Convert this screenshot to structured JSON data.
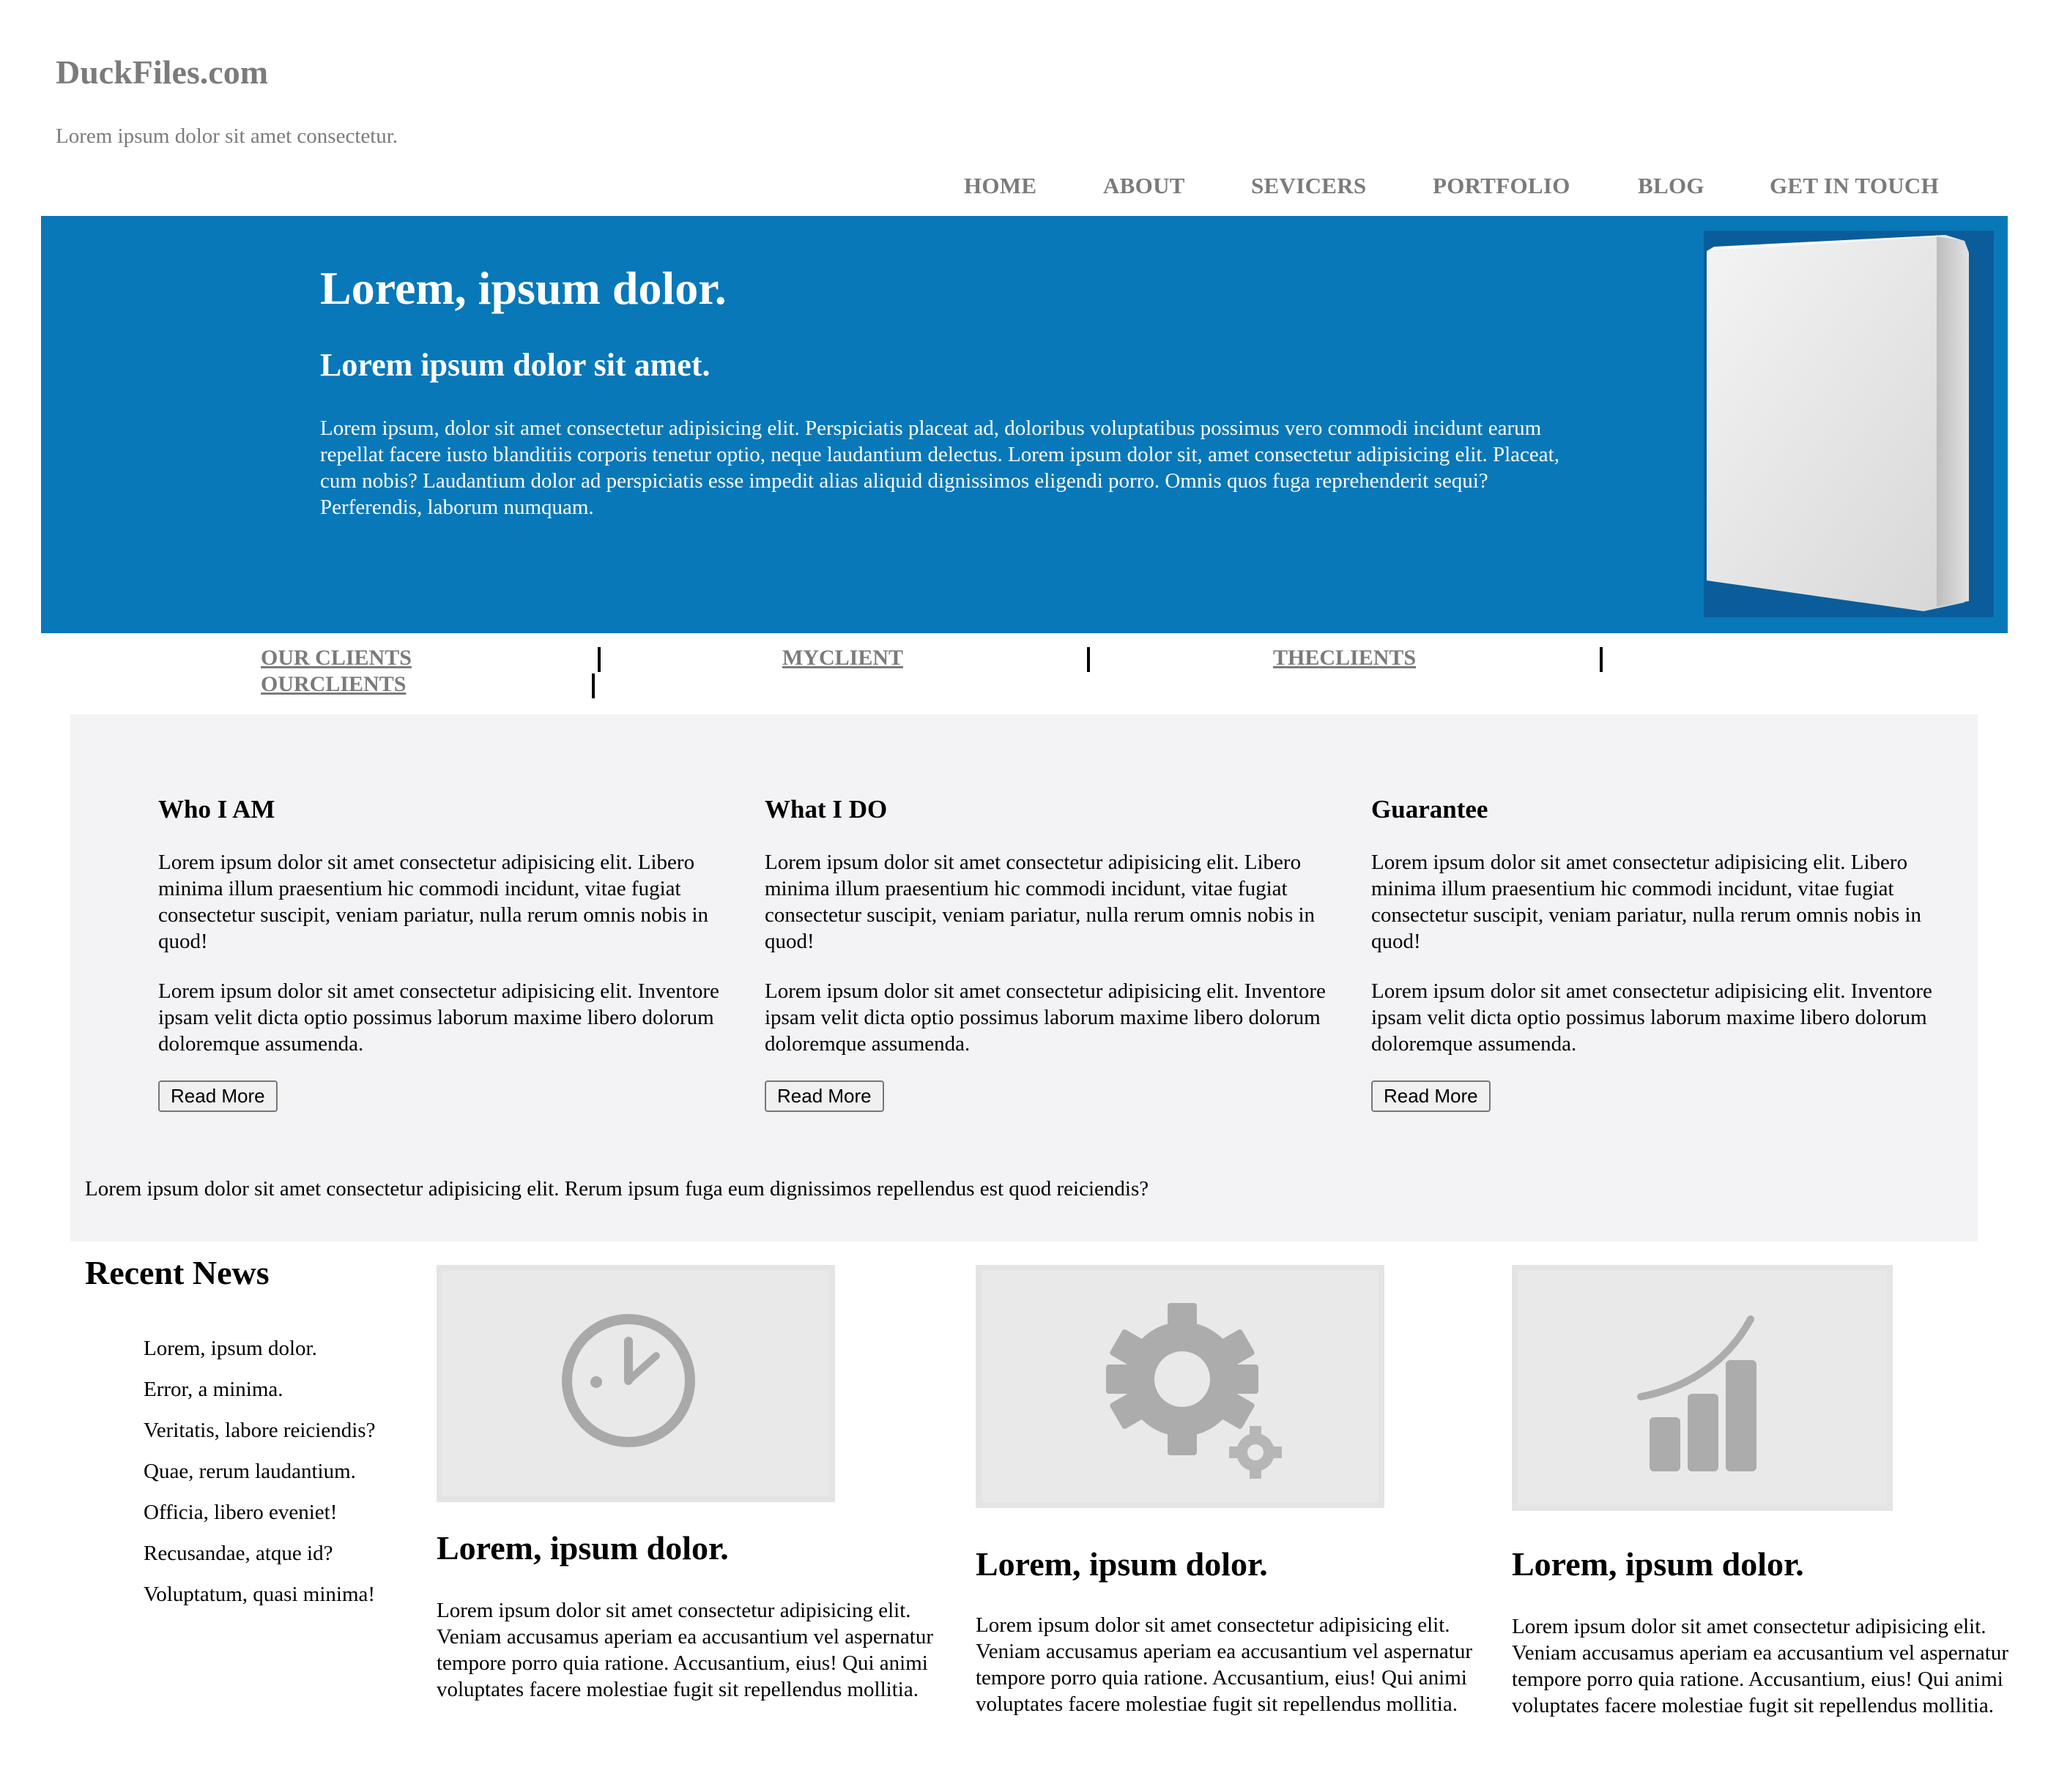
{
  "header": {
    "site_title": "DuckFiles.com",
    "tagline": "Lorem ipsum dolor sit amet consectetur."
  },
  "nav": [
    "HOME",
    "ABOUT",
    "SEVICERS",
    "PORTFOLIO",
    "BLOG",
    "GET IN TOUCH"
  ],
  "hero": {
    "title": "Lorem, ipsum dolor.",
    "subtitle": "Lorem ipsum dolor sit amet.",
    "text": "Lorem ipsum, dolor sit amet consectetur adipisicing elit. Perspiciatis placeat ad, doloribus voluptatibus possimus vero commodi incidunt earum repellat facere iusto blanditiis corporis tenetur optio, neque laudantium delectus. Lorem ipsum dolor sit, amet consectetur adipisicing elit. Placeat, cum nobis? Laudantium dolor ad perspiciatis esse impedit alias aliquid dignissimos eligendi porro. Omnis quos fuga reprehenderit sequi? Perferendis, laborum numquam."
  },
  "clients": [
    "OUR CLIENTS",
    "MYCLIENT",
    "THECLIENTS",
    "OURCLIENTS"
  ],
  "about": {
    "columns": [
      {
        "title": "Who I AM",
        "p1": "Lorem ipsum dolor sit amet consectetur adipisicing elit. Libero minima illum praesentium hic commodi incidunt, vitae fugiat consectetur suscipit, veniam pariatur, nulla rerum omnis nobis in quod!",
        "p2": "Lorem ipsum dolor sit amet consectetur adipisicing elit. Inventore ipsam velit dicta optio possimus laborum maxime libero dolorum doloremque assumenda.",
        "button": "Read More"
      },
      {
        "title": "What I DO",
        "p1": "Lorem ipsum dolor sit amet consectetur adipisicing elit. Libero minima illum praesentium hic commodi incidunt, vitae fugiat consectetur suscipit, veniam pariatur, nulla rerum omnis nobis in quod!",
        "p2": "Lorem ipsum dolor sit amet consectetur adipisicing elit. Inventore ipsam velit dicta optio possimus laborum maxime libero dolorum doloremque assumenda.",
        "button": "Read More"
      },
      {
        "title": "Guarantee",
        "p1": "Lorem ipsum dolor sit amet consectetur adipisicing elit. Libero minima illum praesentium hic commodi incidunt, vitae fugiat consectetur suscipit, veniam pariatur, nulla rerum omnis nobis in quod!",
        "p2": "Lorem ipsum dolor sit amet consectetur adipisicing elit. Inventore ipsam velit dicta optio possimus laborum maxime libero dolorum doloremque assumenda.",
        "button": "Read More"
      }
    ],
    "footer_text": "Lorem ipsum dolor sit amet consectetur adipisicing elit. Rerum ipsum fuga eum dignissimos repellendus est quod reiciendis?"
  },
  "news": {
    "heading": "Recent News",
    "items": [
      "Lorem, ipsum dolor.",
      "Error, a minima.",
      "Veritatis, labore reiciendis?",
      "Quae, rerum laudantium.",
      "Officia, libero eveniet!",
      "Recusandae, atque id?",
      "Voluptatum, quasi minima!"
    ],
    "cards": [
      {
        "icon": "clock-icon",
        "title": "Lorem, ipsum dolor.",
        "text": "Lorem ipsum dolor sit amet consectetur adipisicing elit. Veniam accusamus aperiam ea accusantium vel aspernatur tempore porro quia ratione. Accusantium, eius! Qui animi voluptates facere molestiae fugit sit repellendus mollitia."
      },
      {
        "icon": "gear-icon",
        "title": "Lorem, ipsum dolor.",
        "text": "Lorem ipsum dolor sit amet consectetur adipisicing elit. Veniam accusamus aperiam ea accusantium vel aspernatur tempore porro quia ratione. Accusantium, eius! Qui animi voluptates facere molestiae fugit sit repellendus mollitia."
      },
      {
        "icon": "chart-icon",
        "title": "Lorem, ipsum dolor.",
        "text": "Lorem ipsum dolor sit amet consectetur adipisicing elit. Veniam accusamus aperiam ea accusantium vel aspernatur tempore porro quia ratione. Accusantium, eius! Qui animi voluptates facere molestiae fugit sit repellendus mollitia."
      }
    ]
  },
  "colors": {
    "hero_blue": "#0878b9",
    "muted_gray": "#7b7b7b",
    "section_bg": "#f3f3f5"
  }
}
